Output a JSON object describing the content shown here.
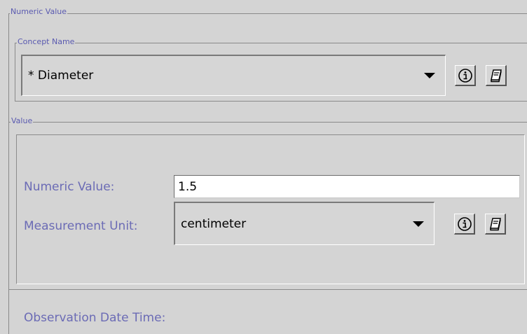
{
  "outer_group": {
    "label": "Numeric Value"
  },
  "concept_group": {
    "label": "Concept Name",
    "combo_value": "* Diameter",
    "info_icon": "info-icon",
    "edit_icon": "edit-book-icon"
  },
  "value_group": {
    "label": "Value",
    "numeric_label": "Numeric Value:",
    "numeric_value": "1.5",
    "unit_label": "Measurement Unit:",
    "unit_value": "centimeter",
    "info_icon": "info-icon",
    "edit_icon": "edit-book-icon"
  },
  "observation": {
    "label": "Observation Date Time:"
  }
}
